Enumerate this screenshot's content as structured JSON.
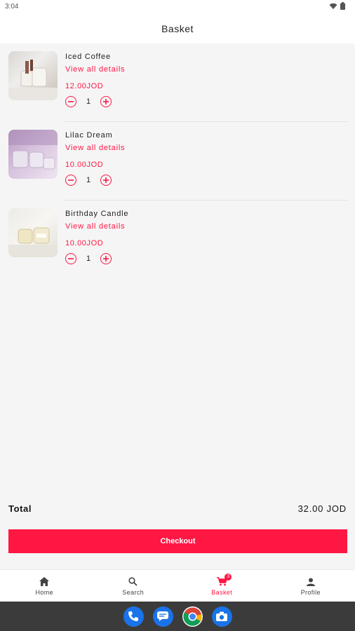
{
  "status": {
    "time": "3:04"
  },
  "header": {
    "title": "Basket"
  },
  "items": [
    {
      "name": "Iced Coffee",
      "link": "View all details",
      "price": "12.00JOD",
      "qty": "1"
    },
    {
      "name": "Lilac Dream",
      "link": "View all details",
      "price": "10.00JOD",
      "qty": "1"
    },
    {
      "name": "Birthday Candle",
      "link": "View all details",
      "price": "10.00JOD",
      "qty": "1"
    }
  ],
  "summary": {
    "total_label": "Total",
    "total_value": "32.00 JOD"
  },
  "checkout": {
    "label": "Checkout"
  },
  "nav": {
    "items": [
      {
        "label": "Home",
        "icon": "home-icon"
      },
      {
        "label": "Search",
        "icon": "search-icon"
      },
      {
        "label": "Basket",
        "icon": "cart-icon",
        "badge": "3",
        "active": true
      },
      {
        "label": "Profile",
        "icon": "person-icon"
      }
    ]
  },
  "dock": {
    "icons": [
      "phone-icon",
      "messages-icon",
      "chrome-icon",
      "camera-icon"
    ]
  },
  "colors": {
    "accent": "#ff1744",
    "background": "#f5f5f5",
    "system_bar": "#3b3b3b"
  }
}
